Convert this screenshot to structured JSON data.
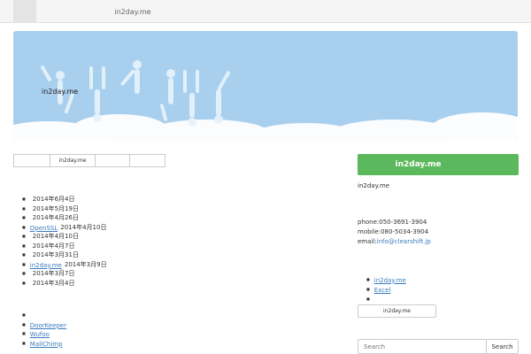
{
  "brand_name": "in2day.me",
  "nav": {
    "items": [
      {
        "label": ""
      },
      {
        "label": ""
      },
      {
        "label_prefix": "in2day.me",
        "label": ""
      },
      {
        "label": ""
      },
      {
        "label": ""
      }
    ]
  },
  "hero": {
    "title": "",
    "subtitle_before": "",
    "subtitle_brand": "in2day.me",
    "subtitle_after": ""
  },
  "sub_tabs": [
    {
      "label": ""
    },
    {
      "label_prefix": "in2day.me",
      "label": ""
    },
    {
      "label": ""
    },
    {
      "label": ""
    }
  ],
  "recent_posts": {
    "title": "",
    "items": [
      {
        "text": "",
        "date": "2014年6月4日"
      },
      {
        "text": "",
        "date": "2014年5月19日"
      },
      {
        "text": "",
        "date": "2014年4月26日"
      },
      {
        "text": "OpenSSL",
        "date": "2014年4月10日"
      },
      {
        "text": "",
        "date": "2014年4月10日"
      },
      {
        "text": "",
        "date": "2014年4月7日"
      },
      {
        "text": "",
        "date": "2014年3月31日"
      },
      {
        "text": "in2day.me",
        "date": "2014年3月9日"
      },
      {
        "text": "",
        "date": "2014年3月7日"
      },
      {
        "text": "",
        "date": "2014年3月4日"
      }
    ]
  },
  "recommended": {
    "title": "",
    "items": [
      {
        "text": ""
      },
      {
        "text": "DoorKeeper"
      },
      {
        "text": "Wufoo"
      },
      {
        "text": "MailChimp"
      }
    ]
  },
  "sidebar": {
    "cta_brand": "in2day.me",
    "cta_suffix": "",
    "intro_before": "",
    "intro_brand": "in2day.me",
    "intro_after": "",
    "contact_title": "",
    "phone": "phone:050-3691-3904",
    "mobile": "mobile:080-5034-3904",
    "email_label": "email:",
    "email": "info@clearshift.jp",
    "address": "",
    "links_title": "",
    "links": [
      {
        "text": "in2day.me"
      },
      {
        "text": "Excel"
      },
      {
        "text": ""
      }
    ],
    "button_brand": "in2day.me",
    "button_label": "",
    "search_heading": "",
    "search_placeholder": "Search",
    "search_button": "Search"
  },
  "colors": {
    "hero_sky": "#a9cfee",
    "cta_green": "#5cb85c",
    "link_blue": "#3a7bbf",
    "logo_yellow": "#f2d21c"
  }
}
